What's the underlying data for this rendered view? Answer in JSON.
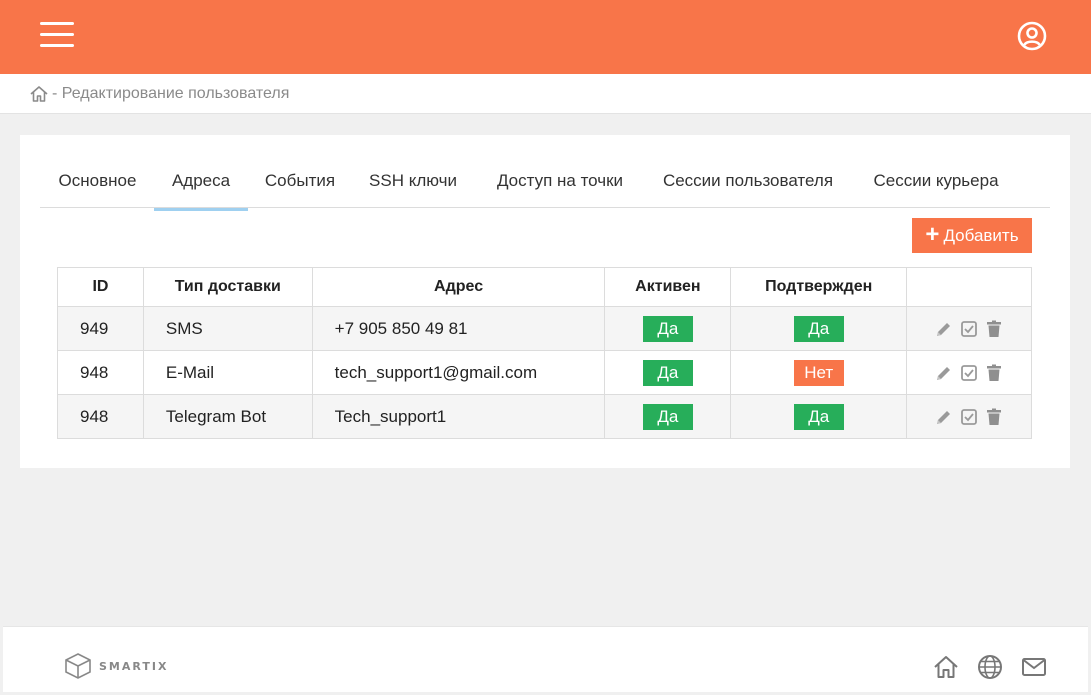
{
  "breadcrumb": {
    "text": "- Редактирование пользователя"
  },
  "tabs": [
    {
      "label": "Основное"
    },
    {
      "label": "Адреса"
    },
    {
      "label": "События"
    },
    {
      "label": "SSH ключи"
    },
    {
      "label": "Доступ на точки"
    },
    {
      "label": "Сессии пользователя"
    },
    {
      "label": "Сессии курьера"
    }
  ],
  "toolbar": {
    "add_label": "Добавить"
  },
  "table": {
    "headers": [
      "ID",
      "Тип доставки",
      "Адрес",
      "Активен",
      "Подтвержден",
      ""
    ],
    "rows": [
      {
        "id": "949",
        "type": "SMS",
        "address": "+7 905 850 49 81",
        "active": "Да",
        "confirmed": "Да"
      },
      {
        "id": "948",
        "type": "E-Mail",
        "address": "tech_support1@gmail.com",
        "active": "Да",
        "confirmed": "Нет"
      },
      {
        "id": "948",
        "type": "Telegram Bot",
        "address": "Tech_support1",
        "active": "Да",
        "confirmed": "Да"
      }
    ]
  },
  "footer": {
    "logo_text": "SMARTIX"
  },
  "colors": {
    "accent": "#f87549",
    "yes": "#27ae5a",
    "tab_active": "#9fd0f0"
  },
  "icons": [
    "menu-icon",
    "user-circle-icon",
    "home-icon",
    "edit-icon",
    "check-icon",
    "trash-icon",
    "globe-icon",
    "mail-icon"
  ]
}
